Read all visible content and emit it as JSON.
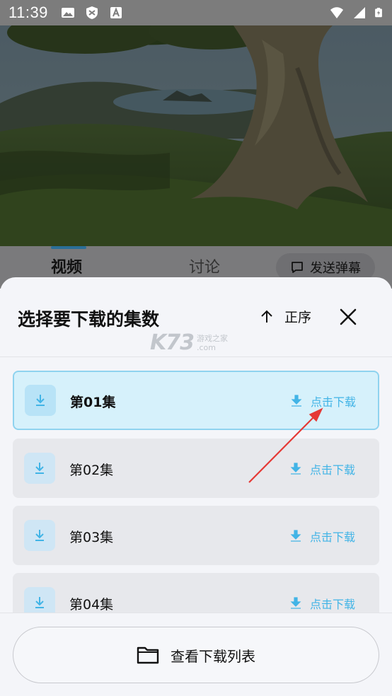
{
  "status_bar": {
    "time": "11:39",
    "left_icons": [
      "image-icon",
      "shield-icon",
      "text-a-icon"
    ],
    "right_icons": [
      "wifi-icon",
      "signal-icon",
      "battery-icon"
    ]
  },
  "video": {
    "description_icon": "video-player"
  },
  "tabs": [
    {
      "label": "视频",
      "active": true
    },
    {
      "label": "讨论",
      "active": false
    }
  ],
  "danmaku": {
    "label": "发送弹幕",
    "icon": "chat-bubble-icon"
  },
  "sheet": {
    "title": "选择要下载的集数",
    "sort_label": "正序",
    "sort_icon": "arrow-up-icon",
    "close_icon": "close-icon",
    "watermark": {
      "logo": "K73",
      "line1": "游戏之家",
      "line2": ".com"
    },
    "episodes": [
      {
        "label": "第01集",
        "action": "点击下载",
        "selected": true
      },
      {
        "label": "第02集",
        "action": "点击下载",
        "selected": false
      },
      {
        "label": "第03集",
        "action": "点击下载",
        "selected": false
      },
      {
        "label": "第04集",
        "action": "点击下载",
        "selected": false
      }
    ],
    "footer_button": {
      "label": "查看下载列表",
      "icon": "folder-icon"
    }
  },
  "colors": {
    "accent": "#42b4e6",
    "selected_bg": "#d6f1fb",
    "selected_border": "#8fd3ef",
    "annotation_arrow": "#e53935"
  }
}
